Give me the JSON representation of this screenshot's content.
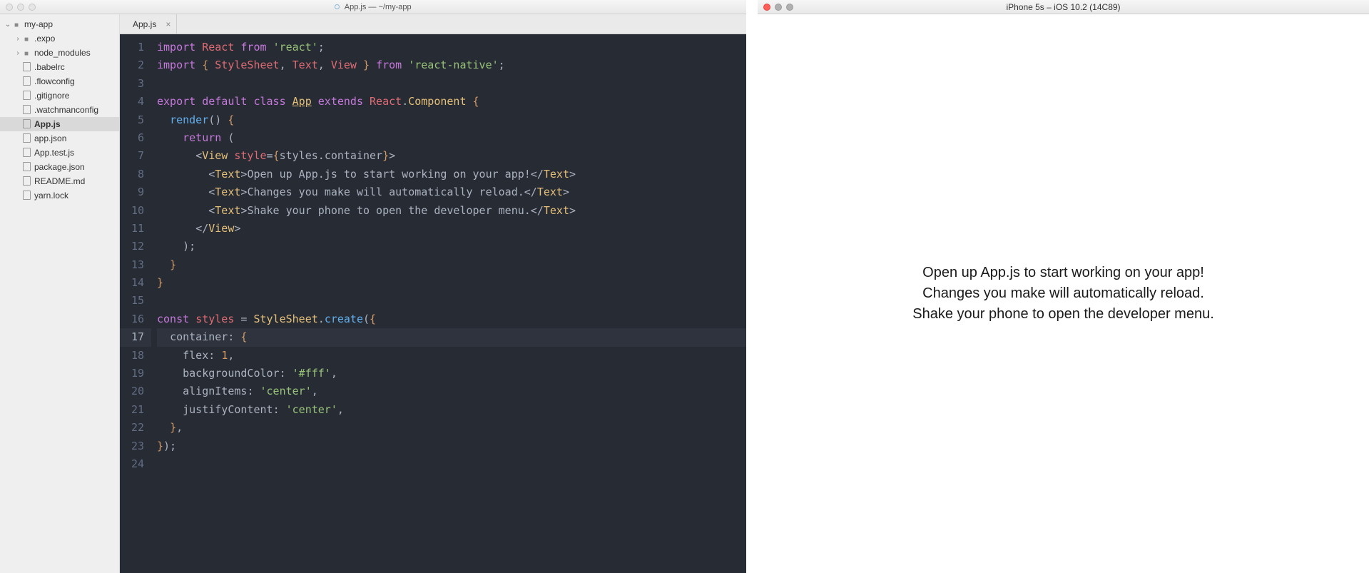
{
  "editor": {
    "titlebar": "App.js — ~/my-app",
    "tree": {
      "root": "my-app",
      "items": [
        {
          "name": ".expo",
          "type": "folder",
          "depth": 1,
          "chev": "›"
        },
        {
          "name": "node_modules",
          "type": "folder",
          "depth": 1,
          "chev": "›"
        },
        {
          "name": ".babelrc",
          "type": "file",
          "depth": 1
        },
        {
          "name": ".flowconfig",
          "type": "file",
          "depth": 1
        },
        {
          "name": ".gitignore",
          "type": "file",
          "depth": 1
        },
        {
          "name": ".watchmanconfig",
          "type": "file",
          "depth": 1
        },
        {
          "name": "App.js",
          "type": "file",
          "depth": 1,
          "selected": true
        },
        {
          "name": "app.json",
          "type": "file",
          "depth": 1
        },
        {
          "name": "App.test.js",
          "type": "file",
          "depth": 1
        },
        {
          "name": "package.json",
          "type": "file",
          "depth": 1
        },
        {
          "name": "README.md",
          "type": "file",
          "depth": 1
        },
        {
          "name": "yarn.lock",
          "type": "file",
          "depth": 1
        }
      ]
    },
    "tab": {
      "label": "App.js"
    },
    "current_line": 17,
    "code_lines": [
      [
        [
          "c-key",
          "import"
        ],
        [
          "c-def",
          " "
        ],
        [
          "c-var",
          "React"
        ],
        [
          "c-def",
          " "
        ],
        [
          "c-key",
          "from"
        ],
        [
          "c-def",
          " "
        ],
        [
          "c-str",
          "'react'"
        ],
        [
          "c-pun",
          ";"
        ]
      ],
      [
        [
          "c-key",
          "import"
        ],
        [
          "c-def",
          " "
        ],
        [
          "c-brk",
          "{"
        ],
        [
          "c-def",
          " "
        ],
        [
          "c-var",
          "StyleSheet"
        ],
        [
          "c-pun",
          ","
        ],
        [
          "c-def",
          " "
        ],
        [
          "c-var",
          "Text"
        ],
        [
          "c-pun",
          ","
        ],
        [
          "c-def",
          " "
        ],
        [
          "c-var",
          "View"
        ],
        [
          "c-def",
          " "
        ],
        [
          "c-brk",
          "}"
        ],
        [
          "c-def",
          " "
        ],
        [
          "c-key",
          "from"
        ],
        [
          "c-def",
          " "
        ],
        [
          "c-str",
          "'react-native'"
        ],
        [
          "c-pun",
          ";"
        ]
      ],
      [
        [
          "c-def",
          ""
        ]
      ],
      [
        [
          "c-key",
          "export"
        ],
        [
          "c-def",
          " "
        ],
        [
          "c-key",
          "default"
        ],
        [
          "c-def",
          " "
        ],
        [
          "c-key",
          "class"
        ],
        [
          "c-def",
          " "
        ],
        [
          "c-cls c-und",
          "App"
        ],
        [
          "c-def",
          " "
        ],
        [
          "c-key",
          "extends"
        ],
        [
          "c-def",
          " "
        ],
        [
          "c-var",
          "React"
        ],
        [
          "c-pun",
          "."
        ],
        [
          "c-cls",
          "Component"
        ],
        [
          "c-def",
          " "
        ],
        [
          "c-brk",
          "{"
        ]
      ],
      [
        [
          "c-def",
          "  "
        ],
        [
          "c-fn",
          "render"
        ],
        [
          "c-pun",
          "()"
        ],
        [
          "c-def",
          " "
        ],
        [
          "c-brk",
          "{"
        ]
      ],
      [
        [
          "c-def",
          "    "
        ],
        [
          "c-key",
          "return"
        ],
        [
          "c-def",
          " "
        ],
        [
          "c-pun",
          "("
        ]
      ],
      [
        [
          "c-def",
          "      "
        ],
        [
          "c-pun",
          "<"
        ],
        [
          "c-cls",
          "View"
        ],
        [
          "c-def",
          " "
        ],
        [
          "c-var",
          "style"
        ],
        [
          "c-pun",
          "="
        ],
        [
          "c-brk",
          "{"
        ],
        [
          "c-def",
          "styles"
        ],
        [
          "c-pun",
          "."
        ],
        [
          "c-def",
          "container"
        ],
        [
          "c-brk",
          "}"
        ],
        [
          "c-pun",
          ">"
        ]
      ],
      [
        [
          "c-def",
          "        "
        ],
        [
          "c-pun",
          "<"
        ],
        [
          "c-cls",
          "Text"
        ],
        [
          "c-pun",
          ">"
        ],
        [
          "c-def",
          "Open up App.js to start working on your app!"
        ],
        [
          "c-pun",
          "</"
        ],
        [
          "c-cls",
          "Text"
        ],
        [
          "c-pun",
          ">"
        ]
      ],
      [
        [
          "c-def",
          "        "
        ],
        [
          "c-pun",
          "<"
        ],
        [
          "c-cls",
          "Text"
        ],
        [
          "c-pun",
          ">"
        ],
        [
          "c-def",
          "Changes you make will automatically reload."
        ],
        [
          "c-pun",
          "</"
        ],
        [
          "c-cls",
          "Text"
        ],
        [
          "c-pun",
          ">"
        ]
      ],
      [
        [
          "c-def",
          "        "
        ],
        [
          "c-pun",
          "<"
        ],
        [
          "c-cls",
          "Text"
        ],
        [
          "c-pun",
          ">"
        ],
        [
          "c-def",
          "Shake your phone to open the developer menu."
        ],
        [
          "c-pun",
          "</"
        ],
        [
          "c-cls",
          "Text"
        ],
        [
          "c-pun",
          ">"
        ]
      ],
      [
        [
          "c-def",
          "      "
        ],
        [
          "c-pun",
          "</"
        ],
        [
          "c-cls",
          "View"
        ],
        [
          "c-pun",
          ">"
        ]
      ],
      [
        [
          "c-def",
          "    "
        ],
        [
          "c-pun",
          ");"
        ]
      ],
      [
        [
          "c-def",
          "  "
        ],
        [
          "c-brk",
          "}"
        ]
      ],
      [
        [
          "c-brk",
          "}"
        ]
      ],
      [
        [
          "c-def",
          ""
        ]
      ],
      [
        [
          "c-key",
          "const"
        ],
        [
          "c-def",
          " "
        ],
        [
          "c-var",
          "styles"
        ],
        [
          "c-def",
          " "
        ],
        [
          "c-pun",
          "="
        ],
        [
          "c-def",
          " "
        ],
        [
          "c-cls",
          "StyleSheet"
        ],
        [
          "c-pun",
          "."
        ],
        [
          "c-fn",
          "create"
        ],
        [
          "c-pun",
          "("
        ],
        [
          "c-brk",
          "{"
        ]
      ],
      [
        [
          "c-def",
          "  "
        ],
        [
          "c-def",
          "container"
        ],
        [
          "c-pun",
          ":"
        ],
        [
          "c-def",
          " "
        ],
        [
          "c-brk",
          "{"
        ]
      ],
      [
        [
          "c-def",
          "    "
        ],
        [
          "c-def",
          "flex"
        ],
        [
          "c-pun",
          ":"
        ],
        [
          "c-def",
          " "
        ],
        [
          "c-num",
          "1"
        ],
        [
          "c-pun",
          ","
        ]
      ],
      [
        [
          "c-def",
          "    "
        ],
        [
          "c-def",
          "backgroundColor"
        ],
        [
          "c-pun",
          ":"
        ],
        [
          "c-def",
          " "
        ],
        [
          "c-str",
          "'#fff'"
        ],
        [
          "c-pun",
          ","
        ]
      ],
      [
        [
          "c-def",
          "    "
        ],
        [
          "c-def",
          "alignItems"
        ],
        [
          "c-pun",
          ":"
        ],
        [
          "c-def",
          " "
        ],
        [
          "c-str",
          "'center'"
        ],
        [
          "c-pun",
          ","
        ]
      ],
      [
        [
          "c-def",
          "    "
        ],
        [
          "c-def",
          "justifyContent"
        ],
        [
          "c-pun",
          ":"
        ],
        [
          "c-def",
          " "
        ],
        [
          "c-str",
          "'center'"
        ],
        [
          "c-pun",
          ","
        ]
      ],
      [
        [
          "c-def",
          "  "
        ],
        [
          "c-brk",
          "}"
        ],
        [
          "c-pun",
          ","
        ]
      ],
      [
        [
          "c-brk",
          "}"
        ],
        [
          "c-pun",
          ");"
        ]
      ],
      [
        [
          "c-def",
          ""
        ]
      ]
    ]
  },
  "simulator": {
    "title": "iPhone 5s – iOS 10.2 (14C89)",
    "lines": [
      "Open up App.js to start working on your app!",
      "Changes you make will automatically reload.",
      "Shake your phone to open the developer menu."
    ]
  }
}
